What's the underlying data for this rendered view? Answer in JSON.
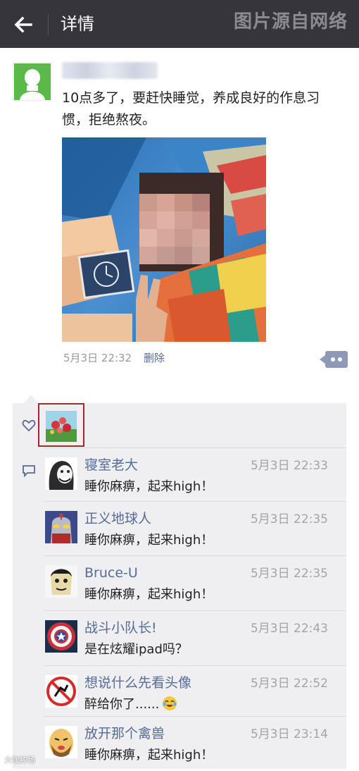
{
  "header": {
    "title": "详情",
    "watermark": "图片源自网络"
  },
  "post": {
    "text": "10点多了，要赶快睡觉，养成良好的作息习惯，拒绝熬夜。",
    "time": "5月3日 22:32",
    "delete_label": "删除"
  },
  "comments": [
    {
      "name": "寝室老大",
      "time": "5月3日 22:33",
      "text": "睡你麻痹，起来high！"
    },
    {
      "name": "正义地球人",
      "time": "5月3日 22:35",
      "text": "睡你麻痹，起来high！"
    },
    {
      "name": "Bruce-U",
      "time": "5月3日 22:35",
      "text": "睡你麻痹，起来high！"
    },
    {
      "name": "战斗小队长!",
      "time": "5月3日 22:43",
      "text": "是在炫耀ipad吗？"
    },
    {
      "name": "想说什么先看头像",
      "time": "5月3日 22:52",
      "text": "醉给你了......"
    },
    {
      "name": "放开那个禽兽",
      "time": "5月3日 23:14",
      "text": "睡你麻痹，起来high！"
    }
  ],
  "footer": {
    "watermark": "大咖捧场"
  },
  "colors": {
    "topbar": "#35353b",
    "link_blue": "#576b95",
    "highlight_border": "#a12a2d"
  }
}
